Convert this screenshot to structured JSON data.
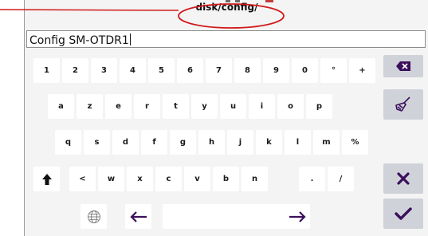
{
  "path": "disk/config/",
  "input": {
    "value": "Config SM-OTDR1"
  },
  "row1": [
    "1",
    "2",
    "3",
    "4",
    "5",
    "6",
    "7",
    "8",
    "9",
    "0",
    "°",
    "+"
  ],
  "row2": [
    "a",
    "z",
    "e",
    "r",
    "t",
    "y",
    "u",
    "i",
    "o",
    "p"
  ],
  "row3": [
    "q",
    "s",
    "d",
    "f",
    "g",
    "h",
    "j",
    "k",
    "l",
    "m",
    "%"
  ],
  "row4": [
    "<",
    "w",
    "x",
    "c",
    "v",
    "b",
    "n",
    ".",
    "/"
  ],
  "colors": {
    "accent": "#3a0f5c",
    "highlight_ellipse": "#d11a1a",
    "func_key_bg": "#d0d2d9"
  },
  "icons": {
    "shift": "shift-up-arrow-icon",
    "backspace": "backspace-icon",
    "clear": "broom-icon",
    "cancel": "close-icon",
    "confirm": "checkmark-icon",
    "language": "globe-icon",
    "cursor_left": "arrow-left-icon",
    "cursor_right": "arrow-right-icon"
  }
}
